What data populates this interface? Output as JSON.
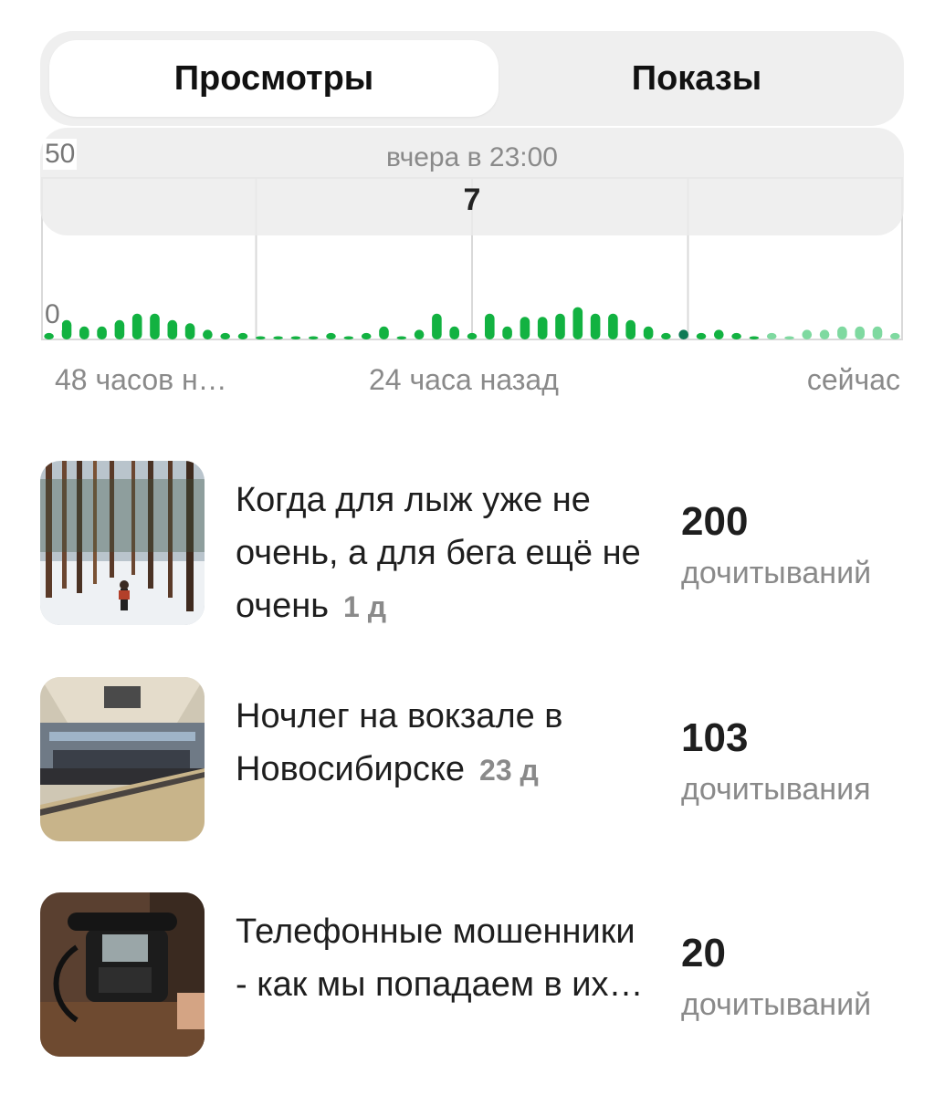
{
  "tabs": {
    "views": "Просмотры",
    "impressions": "Показы",
    "active": "views"
  },
  "chart_data": {
    "type": "bar",
    "y_max_label": "50",
    "y_min_label": "0",
    "ylim": [
      0,
      50
    ],
    "x_labels": [
      "48 часов н…",
      "24 часа назад",
      "сейчас"
    ],
    "tooltip": {
      "time": "вчера в 23:00",
      "value": "7"
    },
    "colors": {
      "bar": "#12b241",
      "highlight": "#0f7a55",
      "recent": "#7fd9a0",
      "grid": "#d9d9d9"
    },
    "highlight_index": 36,
    "recent_from_index": 41,
    "values": [
      2,
      6,
      4,
      4,
      6,
      8,
      8,
      6,
      5,
      3,
      2,
      2,
      1,
      1,
      1,
      1,
      2,
      1,
      2,
      4,
      1,
      3,
      8,
      4,
      2,
      8,
      4,
      7,
      7,
      8,
      10,
      8,
      8,
      6,
      4,
      2,
      3,
      2,
      3,
      2,
      1,
      2,
      1,
      3,
      3,
      4,
      4,
      4,
      2
    ]
  },
  "articles": [
    {
      "title": "Когда для лыж уже не очень, а для бега ещё не очень",
      "age": "1 д",
      "count": "200",
      "label": "дочитываний",
      "image": "forest-run"
    },
    {
      "title": "Ночлег на вокзале в Новосибирске",
      "age": "23 д",
      "count": "103",
      "label": "дочитывания",
      "image": "station-hall"
    },
    {
      "title": "Телефонные мошенники - как мы попадаем в их…",
      "age": "",
      "count": "20",
      "label": "дочитываний",
      "image": "old-phone"
    }
  ]
}
